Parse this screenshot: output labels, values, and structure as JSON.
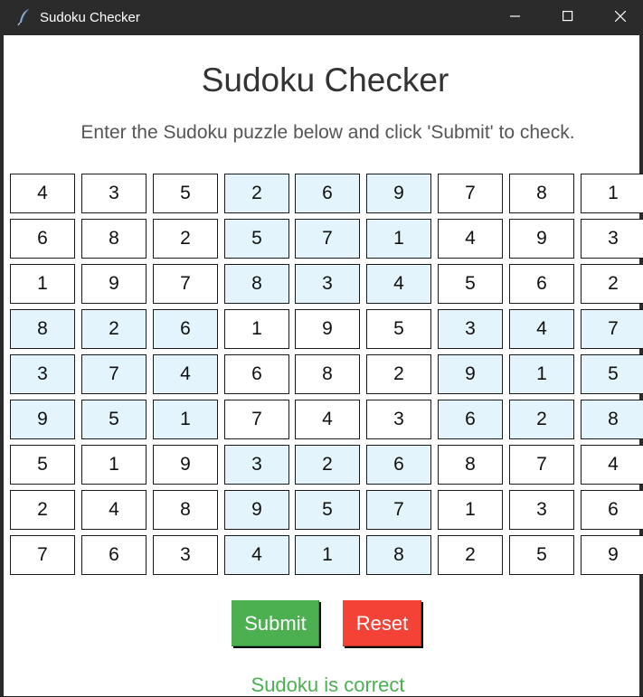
{
  "window": {
    "title": "Sudoku Checker",
    "icon": "feather-icon"
  },
  "header": {
    "title": "Sudoku Checker",
    "instructions": "Enter the Sudoku puzzle below and click 'Submit' to check."
  },
  "grid": {
    "values": [
      [
        "4",
        "3",
        "5",
        "2",
        "6",
        "9",
        "7",
        "8",
        "1"
      ],
      [
        "6",
        "8",
        "2",
        "5",
        "7",
        "1",
        "4",
        "9",
        "3"
      ],
      [
        "1",
        "9",
        "7",
        "8",
        "3",
        "4",
        "5",
        "6",
        "2"
      ],
      [
        "8",
        "2",
        "6",
        "1",
        "9",
        "5",
        "3",
        "4",
        "7"
      ],
      [
        "3",
        "7",
        "4",
        "6",
        "8",
        "2",
        "9",
        "1",
        "5"
      ],
      [
        "9",
        "5",
        "1",
        "7",
        "4",
        "3",
        "6",
        "2",
        "8"
      ],
      [
        "5",
        "1",
        "9",
        "3",
        "2",
        "6",
        "8",
        "7",
        "4"
      ],
      [
        "2",
        "4",
        "8",
        "9",
        "5",
        "7",
        "1",
        "3",
        "6"
      ],
      [
        "7",
        "6",
        "3",
        "4",
        "1",
        "8",
        "2",
        "5",
        "9"
      ]
    ],
    "shaded_color": "#e3f4fc",
    "focused_cell": "row 9, column 9"
  },
  "buttons": {
    "submit_label": "Submit",
    "submit_color": "#4caf50",
    "reset_label": "Reset",
    "reset_color": "#f44336"
  },
  "status": {
    "message": "Sudoku is correct",
    "color": "#4caf50"
  }
}
